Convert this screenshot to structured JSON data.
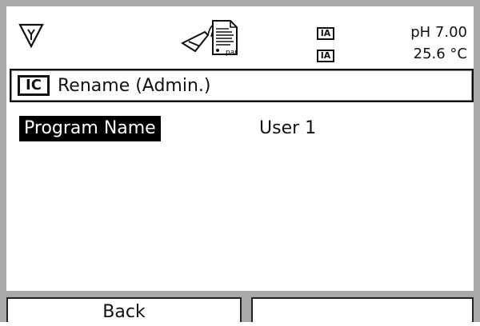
{
  "header": {
    "badges": [
      "IA",
      "IA"
    ],
    "ph_value": "pH 7.00",
    "temperature": "25.6 °C",
    "doc_icon_caption": "par"
  },
  "title_bar": {
    "badge": "IC",
    "title": "Rename (Admin.)"
  },
  "fields": [
    {
      "label": "Program Name",
      "value": "User 1"
    }
  ],
  "softkeys": {
    "left": "Back",
    "right": ""
  },
  "colors": {
    "frame": "#a9a9a9",
    "highlight_bg": "#000000",
    "highlight_text": "#ffffff"
  }
}
